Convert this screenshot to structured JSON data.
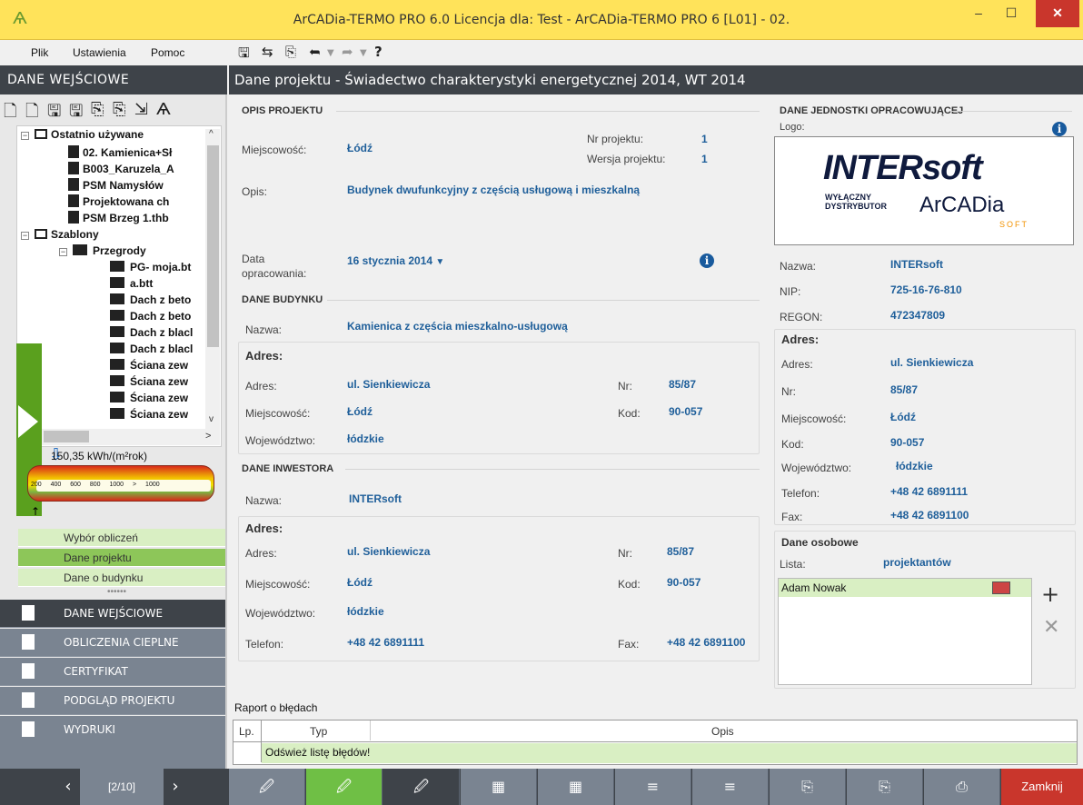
{
  "window": {
    "title": "ArCADia-TERMO PRO 6.0 Licencja dla: Test - ArCADia-TERMO PRO 6 [L01] - 02.",
    "minimize": "–",
    "maximize": "☐",
    "close": "✕"
  },
  "menu": {
    "file": "Plik",
    "settings": "Ustawienia",
    "help": "Pomoc"
  },
  "toolbar": {
    "save": "🖫",
    "refresh": "⇆",
    "preview": "⎘",
    "undo": "➦",
    "redo": "➦",
    "help": "?"
  },
  "sidebar": {
    "header": "DANE WEJŚCIOWE",
    "tree": {
      "recent_label": "Ostatnio używane",
      "recent": [
        "02. Kamienica+Sł",
        "B003_Karuzela_A",
        "PSM Namysłów",
        "Projektowana ch",
        "PSM Brzeg 1.thb"
      ],
      "templates_label": "Szablony",
      "partitions_label": "Przegrody",
      "partitions": [
        "PG- moja.bt",
        "a.btt",
        "Dach z beto",
        "Dach z beto",
        "Dach z blacl",
        "Dach z blacl",
        "Ściana zew",
        "Ściana zew",
        "Ściana zew",
        "Ściana zew"
      ]
    },
    "energy": {
      "value": "150,35 kWh/(m²rok)",
      "scale": "200 400 600 800 1000 > 1000"
    },
    "nav": [
      "Wybór obliczeń",
      "Dane projektu",
      "Dane o budynku"
    ],
    "nav_dots": "••••••",
    "sections": [
      "DANE WEJŚCIOWE",
      "OBLICZENIA CIEPLNE",
      "CERTYFIKAT",
      "PODGLĄD PROJEKTU",
      "WYDRUKI"
    ]
  },
  "main": {
    "title": "Dane projektu - Świadectwo charakterystyki energetycznej 2014, WT 2014",
    "opis": {
      "section": "OPIS PROJEKTU",
      "city_label": "Miejscowość:",
      "city": "Łódź",
      "nr_label": "Nr projektu:",
      "nr": "1",
      "ver_label": "Wersja projektu:",
      "ver": "1",
      "desc_label": "Opis:",
      "desc": "Budynek dwufunkcyjny z częścią usługową i mieszkalną",
      "date_label_1": "Data",
      "date_label_2": "opracowania:",
      "date": "16 stycznia 2014"
    },
    "budynek": {
      "section": "DANE BUDYNKU",
      "name_label": "Nazwa:",
      "name": "Kamienica z częścia mieszkalno-usługową",
      "addr_section": "Adres:",
      "street_label": "Adres:",
      "street": "ul. Sienkiewicza",
      "nr_label": "Nr:",
      "nr": "85/87",
      "city_label": "Miejscowość:",
      "city": "Łódź",
      "code_label": "Kod:",
      "code": "90-057",
      "voiv_label": "Województwo:",
      "voiv": "łódzkie"
    },
    "inwestor": {
      "section": "DANE INWESTORA",
      "name_label": "Nazwa:",
      "name": "INTERsoft",
      "addr_section": "Adres:",
      "street_label": "Adres:",
      "street": "ul. Sienkiewicza",
      "nr_label": "Nr:",
      "nr": "85/87",
      "city_label": "Miejscowość:",
      "city": "Łódź",
      "code_label": "Kod:",
      "code": "90-057",
      "voiv_label": "Województwo:",
      "voiv": "łódzkie",
      "phone_label": "Telefon:",
      "phone": "+48 42 6891111",
      "fax_label": "Fax:",
      "fax": "+48 42 6891100"
    },
    "jednostka": {
      "section": "DANE JEDNOSTKI OPRACOWUJĄCEJ",
      "logo_label": "Logo:",
      "logo_main": "INTERsoft",
      "logo_sub": "WYŁĄCZNY DYSTRYBUTOR",
      "logo_arcadia": "ArCADia",
      "logo_soft": "SOFT",
      "name_label": "Nazwa:",
      "name": "INTERsoft",
      "nip_label": "NIP:",
      "nip": "725-16-76-810",
      "regon_label": "REGON:",
      "regon": "472347809",
      "addr_section": "Adres:",
      "street_label": "Adres:",
      "street": "ul. Sienkiewicza",
      "nr_label": "Nr:",
      "nr": "85/87",
      "city_label": "Miejscowość:",
      "city": "Łódź",
      "code_label": "Kod:",
      "code": "90-057",
      "voiv_label": "Województwo:",
      "voiv": "łódzkie",
      "phone_label": "Telefon:",
      "phone": "+48 42 6891111",
      "fax_label": "Fax:",
      "fax": "+48 42 6891100",
      "persons_section": "Dane osobowe",
      "list_label": "Lista:",
      "list": "projektantów",
      "person": "Adam Nowak"
    },
    "report": {
      "label": "Raport o błędach",
      "col_lp": "Lp.",
      "col_type": "Typ",
      "col_desc": "Opis",
      "row": "Odśwież listę błędów!"
    }
  },
  "bottom": {
    "pager": "[2/10]",
    "close": "Zamknij"
  },
  "colors": {
    "title_bg": "#ffe35a",
    "dark": "#3e4349",
    "green": "#8dc659",
    "value_blue": "#1f5f9a",
    "close_red": "#c9362c"
  }
}
